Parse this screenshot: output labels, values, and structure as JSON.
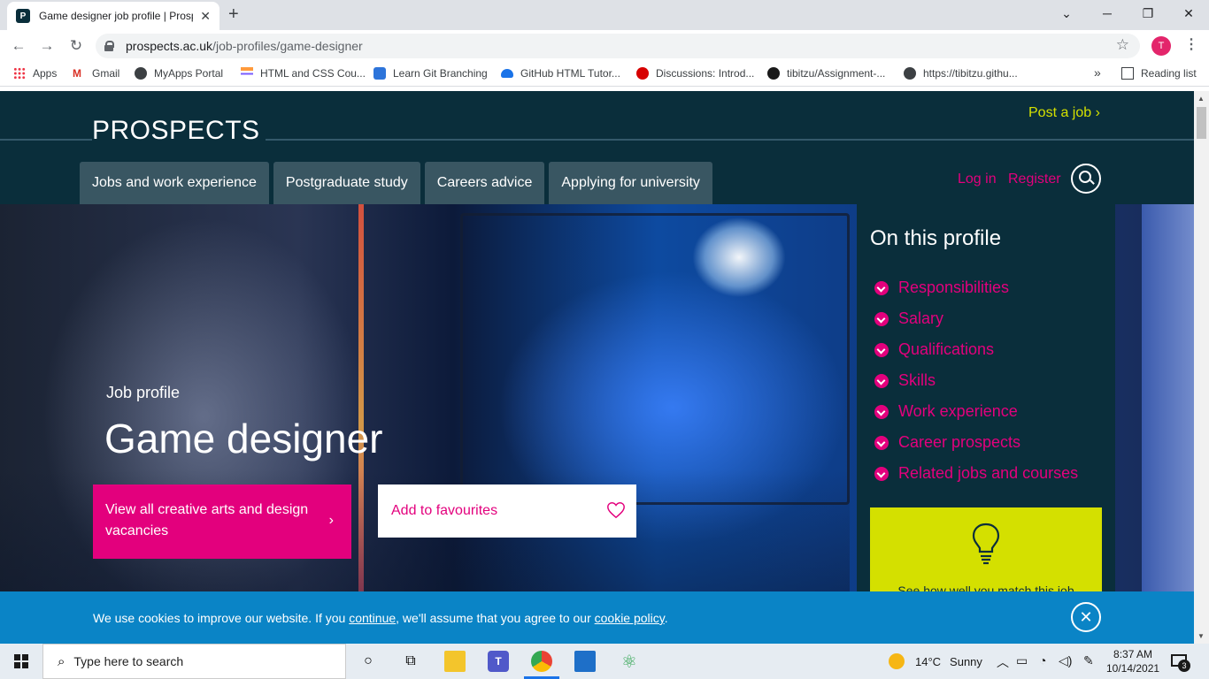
{
  "browser": {
    "tab_title": "Game designer job profile | Prospects.ac.uk",
    "tab_favicon_letter": "P",
    "close_glyph": "✕",
    "new_tab_glyph": "+",
    "window_controls": {
      "minimize": "─",
      "restore": "❐",
      "close": "✕"
    },
    "url_domain": "prospects.ac.uk",
    "url_path": "/job-profiles/game-designer",
    "profile_initial": "T",
    "bookmarks": [
      {
        "label": "Apps",
        "icon": "apps-grid-icon"
      },
      {
        "label": "Gmail",
        "icon": "gmail-icon"
      },
      {
        "label": "MyApps Portal",
        "icon": "globe-icon"
      },
      {
        "label": "HTML and CSS Cou...",
        "icon": "course-icon"
      },
      {
        "label": "Learn Git Branching",
        "icon": "git-icon"
      },
      {
        "label": "GitHub HTML Tutor...",
        "icon": "cloud-icon"
      },
      {
        "label": "Discussions: Introd...",
        "icon": "discussions-icon"
      },
      {
        "label": "tibitzu/Assignment-...",
        "icon": "github-icon"
      },
      {
        "label": "https://tibitzu.githu...",
        "icon": "globe-icon"
      }
    ],
    "bookmarks_overflow": "»",
    "reading_list": "Reading list"
  },
  "site": {
    "logo": "PROSPECTS",
    "post_job": "Post a job ›",
    "nav_tabs": [
      "Jobs and work experience",
      "Postgraduate study",
      "Careers advice",
      "Applying for university"
    ],
    "login": "Log in",
    "register": "Register"
  },
  "hero": {
    "label": "Job profile",
    "title": "Game designer",
    "vacancies_button": "View all creative arts and design vacancies",
    "vacancies_chevron": "›",
    "favourites_button": "Add to favourites"
  },
  "profile_panel": {
    "heading": "On this profile",
    "links": [
      "Responsibilities",
      "Salary",
      "Qualifications",
      "Skills",
      "Work experience",
      "Career prospects",
      "Related jobs and courses"
    ],
    "match_text": "See how well you match this job"
  },
  "cookie_banner": {
    "text_before": "We use cookies to improve our website. If you ",
    "link_continue": "continue",
    "text_middle": ", we'll assume that you agree to our ",
    "link_policy": "cookie policy",
    "text_after": ".",
    "close_glyph": "✕"
  },
  "taskbar": {
    "search_placeholder": "Type here to search",
    "weather_temp": "14°C",
    "weather_desc": "Sunny",
    "time": "8:37 AM",
    "date": "10/14/2021",
    "notification_count": "3"
  },
  "colors": {
    "brand_navy": "#0a2e3b",
    "accent_magenta": "#e3007d",
    "accent_lime": "#d4e000",
    "cookie_blue": "#0a84c6"
  }
}
